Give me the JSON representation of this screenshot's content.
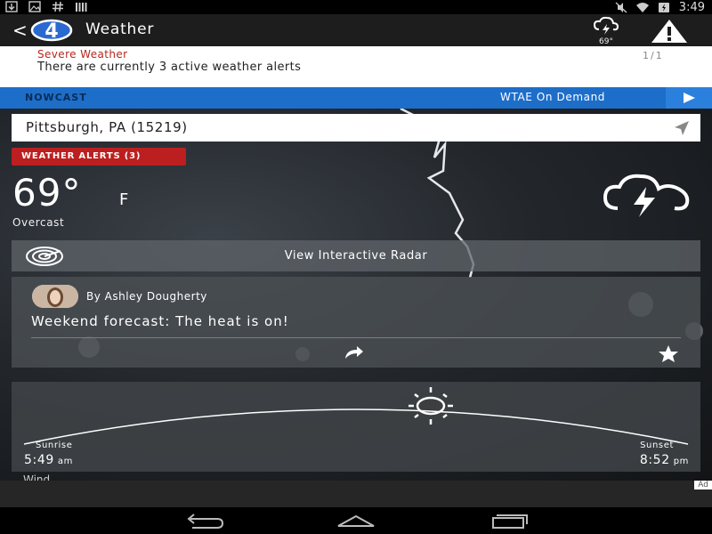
{
  "status_bar": {
    "time": "3:49",
    "left_icons": [
      "download-icon",
      "image-icon",
      "hash-icon",
      "signal-bars-icon"
    ],
    "right_icons": [
      "mute-icon",
      "wifi-icon",
      "battery-icon"
    ]
  },
  "app_bar": {
    "back_icon": "chevron-left-icon",
    "logo": "4",
    "title": "Weather",
    "current_temp_small": "69°",
    "alert_icon": "warning-triangle-icon"
  },
  "alert_banner": {
    "title": "Severe Weather",
    "message": "There are currently 3 active weather alerts",
    "pager": "1/1"
  },
  "nowcast_bar": {
    "label": "NOWCAST",
    "on_demand": "WTAE On Demand"
  },
  "location": {
    "value": "Pittsburgh, PA (15219)"
  },
  "weather_alerts_chip": "WEATHER ALERTS (3)",
  "current": {
    "temperature": "69°",
    "unit": "F",
    "condition": "Overcast",
    "icon": "thunderstorm-icon"
  },
  "radar": {
    "label": "View Interactive Radar",
    "icon": "radar-icon"
  },
  "story": {
    "byline": "By Ashley Dougherty",
    "headline": "Weekend forecast: The heat is on!"
  },
  "sun": {
    "sunrise_label": "Sunrise",
    "sunrise_time": "5:49",
    "sunrise_ampm": "am",
    "sunset_label": "Sunset",
    "sunset_time": "8:52",
    "sunset_ampm": "pm"
  },
  "partial_row_text": "Wind",
  "ad_badge": "Ad",
  "colors": {
    "appbar": "#1d1d1d",
    "nowcast_blue": "#1d6ec9",
    "alert_red": "#bc1f1f"
  }
}
